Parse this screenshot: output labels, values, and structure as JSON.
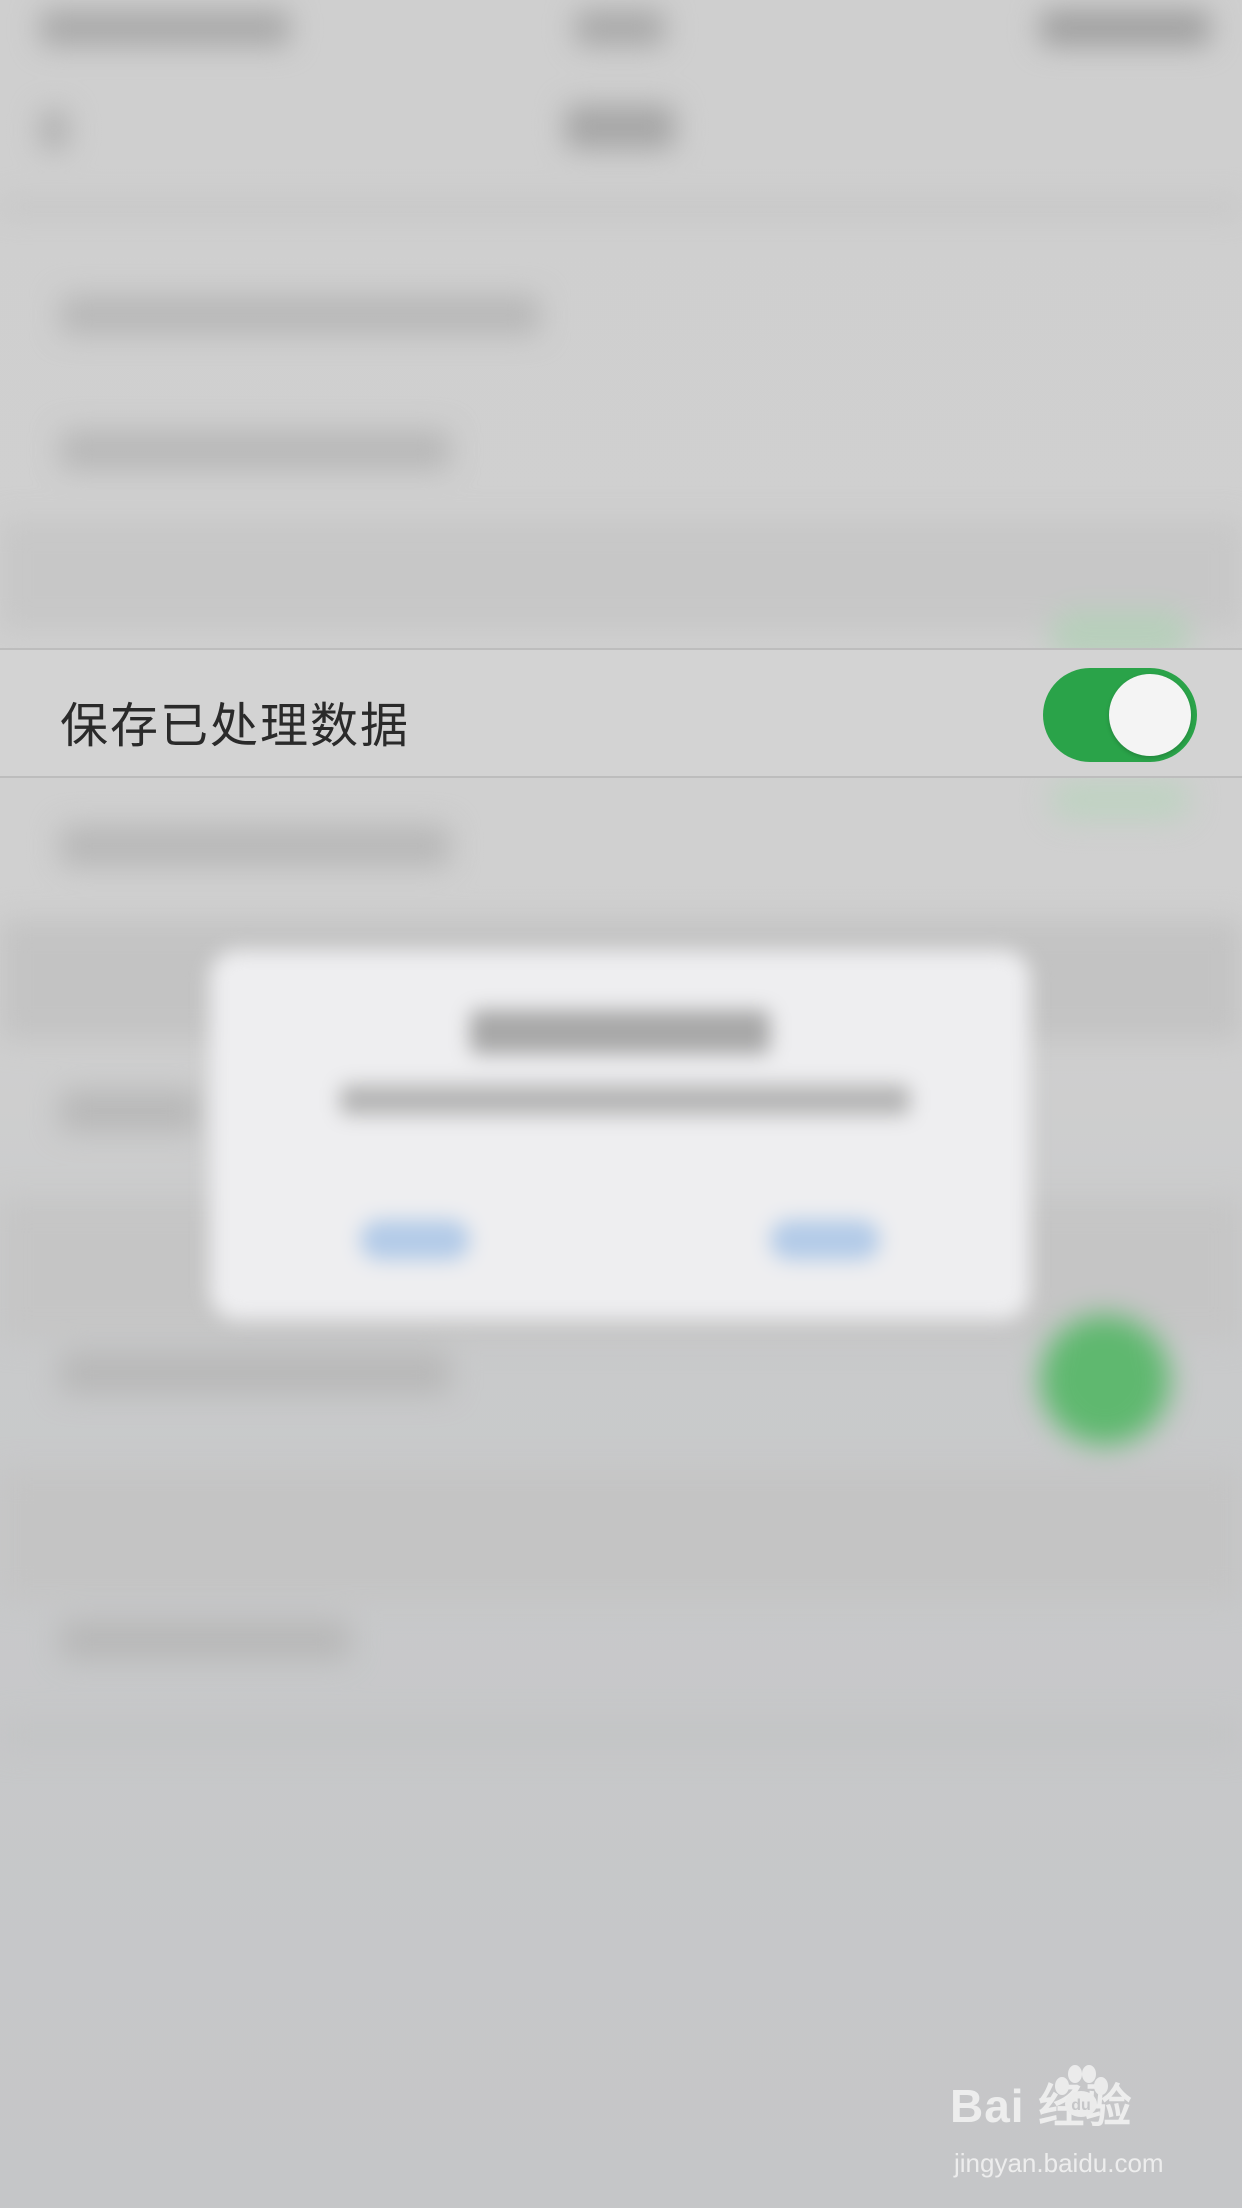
{
  "settings_row": {
    "label": "保存已处理数据",
    "toggle_on": true,
    "toggle_color": "#2aa349"
  },
  "watermark": {
    "logo_text": "Bai  经验",
    "url_text": "jingyan.baidu.com"
  }
}
